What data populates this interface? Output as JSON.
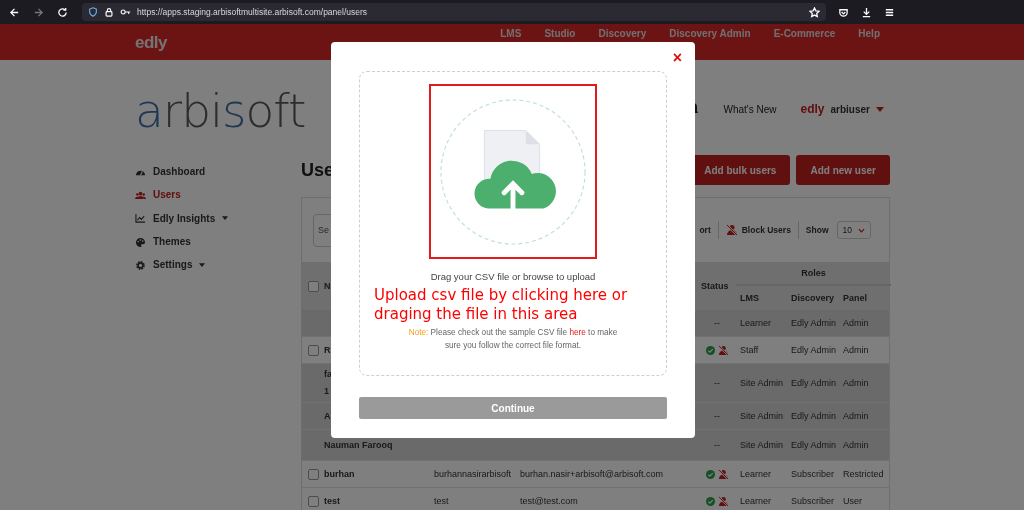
{
  "browser": {
    "url": "https://apps.staging.arbisoftmultisite.arbisoft.com/panel/users"
  },
  "topnav": {
    "logo": "edly",
    "links": [
      "LMS",
      "Studio",
      "Discovery",
      "Discovery Admin",
      "E-Commerce",
      "Help"
    ]
  },
  "header": {
    "logo": [
      "a",
      "rbi",
      "s",
      "oft"
    ],
    "whats_new": "What's New",
    "user_logo": "edly",
    "username": "arbiuser"
  },
  "sidebar": {
    "items": [
      {
        "label": "Dashboard",
        "selected": false,
        "dropdown": false
      },
      {
        "label": "Users",
        "selected": true,
        "dropdown": false
      },
      {
        "label": "Edly Insights",
        "selected": false,
        "dropdown": true
      },
      {
        "label": "Themes",
        "selected": false,
        "dropdown": false
      },
      {
        "label": "Settings",
        "selected": false,
        "dropdown": true
      }
    ]
  },
  "content": {
    "title": "Use",
    "buttons": [
      "Add bulk users",
      "Add new user"
    ]
  },
  "table": {
    "search": {
      "placeholder": "Se"
    },
    "export": "ort",
    "block": "Block Users",
    "show": "Show",
    "page_size": "10",
    "header": {
      "checked": false,
      "name": "N",
      "status": "Status",
      "roles": "Roles",
      "lms": "LMS",
      "discovery": "Discovery",
      "panel": "Panel"
    },
    "rows": [
      {
        "kind": "plain",
        "highlighted": true,
        "active": false,
        "status": "--",
        "lms": "Learner",
        "discovery": "Edly Admin",
        "panel": "Admin"
      },
      {
        "kind": "checkbox",
        "checked": false,
        "highlighted": false,
        "name": "R",
        "active": true,
        "lms": "Staff",
        "discovery": "Edly Admin",
        "panel": "Admin"
      },
      {
        "kind": "plain",
        "highlighted": true,
        "name": "fa\n1",
        "active": false,
        "status": "--",
        "lms": "Site Admin",
        "discovery": "Edly Admin",
        "panel": "Admin"
      },
      {
        "kind": "plain",
        "highlighted": true,
        "name": "A",
        "active": false,
        "status": "--",
        "lms": "Site Admin",
        "discovery": "Edly Admin",
        "panel": "Admin"
      },
      {
        "kind": "plain",
        "highlighted": true,
        "name": "Nauman Farooq",
        "active": false,
        "status": "--",
        "lms": "Site Admin",
        "discovery": "Edly Admin",
        "panel": "Admin"
      },
      {
        "kind": "checkbox",
        "checked": false,
        "highlighted": false,
        "name": "burhan",
        "username": "burhannasirarbisoft",
        "email": "burhan.nasir+arbisoft@arbisoft.com",
        "active": true,
        "lms": "Learner",
        "discovery": "Subscriber",
        "panel": "Restricted"
      },
      {
        "kind": "checkbox",
        "checked": false,
        "highlighted": false,
        "name": "test",
        "username": "test",
        "email": "test@test.com",
        "active": true,
        "lms": "Learner",
        "discovery": "Subscriber",
        "panel": "User"
      }
    ]
  },
  "modal": {
    "close": "×",
    "drop_text": "Drag your CSV file or browse to upload",
    "annotation": "Upload csv file by clicking here or draging the file in this area",
    "note": {
      "label": "Note:",
      "text": "Please check out the sample CSV file",
      "link": "here",
      "text_after": "to make sure you follow the correct file format."
    },
    "continue": {
      "label": "Continue",
      "disabled": true
    }
  }
}
